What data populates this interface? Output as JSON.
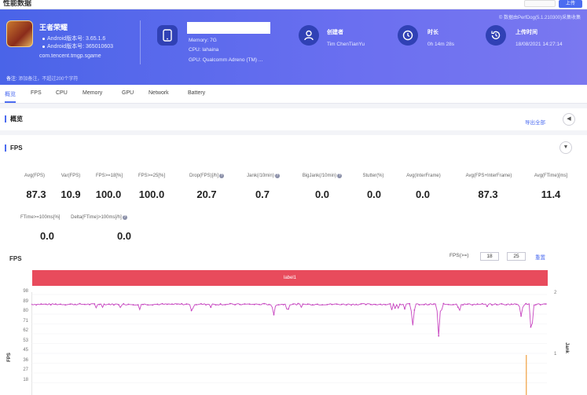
{
  "topbar": {
    "title": "性能数据",
    "export_btn": "上传"
  },
  "app": {
    "name": "王者荣耀",
    "android_version": "Android版本号: 3.65.1.6",
    "android_build": "Android版本号: 365010603",
    "package": "com.tencent.tmgp.sgame",
    "note_label": "备注:",
    "note_placeholder": "添加备注，不超过200个字符"
  },
  "device": {
    "memory": "Memory: 7G",
    "cpu": "CPU: lahaina",
    "gpu": "GPU: Qualcomm Adreno (TM) ..."
  },
  "creator": {
    "label": "创建者",
    "value": "Tim ChenTianYu"
  },
  "duration": {
    "label": "时长",
    "value": "0h 14m 28s"
  },
  "upload": {
    "label": "上传时间",
    "value": "18/08/2021 14:27:14"
  },
  "header_note": "© 数据由PerfDog(5.1.210300)采集收集",
  "tabs": [
    "概览",
    "FPS",
    "CPU",
    "Memory",
    "GPU",
    "Network",
    "Battery"
  ],
  "overview": {
    "title": "概览",
    "export_all": "导出全部"
  },
  "fps_section": {
    "title": "FPS"
  },
  "stats": [
    {
      "label": "Avg(FPS)",
      "value": "87.3"
    },
    {
      "label": "Var(FPS)",
      "value": "10.9"
    },
    {
      "label": "FPS>=18[%]",
      "value": "100.0"
    },
    {
      "label": "FPS>=25[%]",
      "value": "100.0"
    },
    {
      "label": "Drop(FPS)[/h]",
      "value": "20.7"
    },
    {
      "label": "Jank(/10min)",
      "value": "0.7"
    },
    {
      "label": "BigJank(/10min)",
      "value": "0.0"
    },
    {
      "label": "Stutter(%)",
      "value": "0.0"
    },
    {
      "label": "Avg(InterFrame)",
      "value": "0.0"
    },
    {
      "label": "Avg(FPS+InterFrame)",
      "value": "87.3"
    },
    {
      "label": "Avg(FTime)[ms]",
      "value": "11.4"
    },
    {
      "label": "FTime>=100ms[%]",
      "value": "0.0"
    },
    {
      "label": "Delta(FTime)>100ms[/h]",
      "value": "0.0"
    }
  ],
  "chart_filter": {
    "label": "FPS(>=)",
    "v1": "18",
    "v2": "25",
    "reset": "重置"
  },
  "chart_data": {
    "type": "line",
    "title": "FPS",
    "label_bar": "label1",
    "ylabel": "FPS",
    "y2label": "Jank",
    "yticks": [
      "98",
      "89",
      "80",
      "71",
      "62",
      "53",
      "45",
      "36",
      "27",
      "18"
    ],
    "y2ticks": [
      "2",
      "1"
    ],
    "ylim": [
      18,
      98
    ],
    "series": [
      {
        "name": "FPS",
        "color": "#c744c0",
        "baseline": 90,
        "dips": [
          [
            0.47,
            81
          ],
          [
            0.74,
            72
          ],
          [
            0.79,
            64
          ],
          [
            0.83,
            84
          ],
          [
            0.95,
            80
          ],
          [
            0.97,
            62
          ]
        ]
      },
      {
        "name": "Jank",
        "color": "#f0a040",
        "spikes": [
          [
            0.96,
            1
          ]
        ]
      }
    ]
  }
}
